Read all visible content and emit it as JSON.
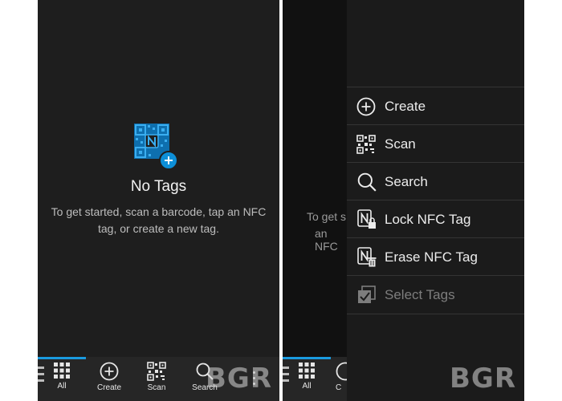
{
  "left_screen": {
    "empty_state": {
      "title": "No Tags",
      "description": "To get started, scan a barcode, tap an NFC tag, or create a new tag."
    },
    "bottom_bar": {
      "items": [
        {
          "label": "All",
          "icon": "grid-icon"
        },
        {
          "label": "Create",
          "icon": "plus-circle-icon"
        },
        {
          "label": "Scan",
          "icon": "qr-code-icon"
        },
        {
          "label": "Search",
          "icon": "search-icon"
        }
      ]
    }
  },
  "right_screen": {
    "background_text": [
      "To get s",
      "an NFC"
    ],
    "menu": {
      "items": [
        {
          "label": "Create",
          "icon": "plus-circle-icon",
          "enabled": true
        },
        {
          "label": "Scan",
          "icon": "qr-code-icon",
          "enabled": true
        },
        {
          "label": "Search",
          "icon": "search-icon",
          "enabled": true
        },
        {
          "label": "Lock NFC Tag",
          "icon": "nfc-lock-icon",
          "enabled": true
        },
        {
          "label": "Erase NFC Tag",
          "icon": "nfc-erase-icon",
          "enabled": true
        },
        {
          "label": "Select Tags",
          "icon": "select-tags-icon",
          "enabled": false
        }
      ]
    },
    "bottom_bar": {
      "items": [
        {
          "label": "All",
          "icon": "grid-icon"
        },
        {
          "label": "C",
          "icon": "plus-circle-icon"
        }
      ]
    }
  },
  "watermark": "BGR",
  "colors": {
    "accent": "#1a9be0",
    "screen_bg": "#1e1e1e",
    "text": "#f2f2f2",
    "disabled": "#7d7d7d"
  }
}
